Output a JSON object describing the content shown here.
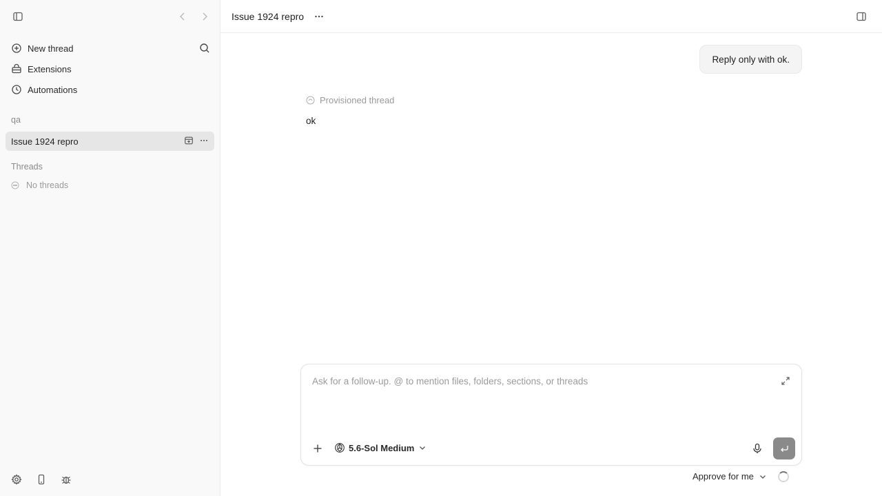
{
  "sidebar": {
    "nav": [
      {
        "label": "New thread",
        "icon": "plus-circle-icon"
      },
      {
        "label": "Extensions",
        "icon": "extensions-icon"
      },
      {
        "label": "Automations",
        "icon": "clock-icon"
      }
    ],
    "project_section_label": "qa",
    "project_item_label": "Issue 1924 repro",
    "threads_section_label": "Threads",
    "threads_empty_label": "No threads"
  },
  "header": {
    "title": "Issue 1924 repro"
  },
  "conversation": {
    "user_message": "Reply only with ok.",
    "provisioned_label": "Provisioned thread",
    "assistant_reply": "ok"
  },
  "composer": {
    "placeholder": "Ask for a follow-up. @ to mention files, folders, sections, or threads",
    "model_label": "5.6-Sol Medium",
    "approval_label": "Approve for me"
  },
  "colors": {
    "sidebar_bg": "#f9f9f9",
    "selected_item_bg": "#e6e6e6",
    "send_button_bg": "#8a8a8a"
  }
}
